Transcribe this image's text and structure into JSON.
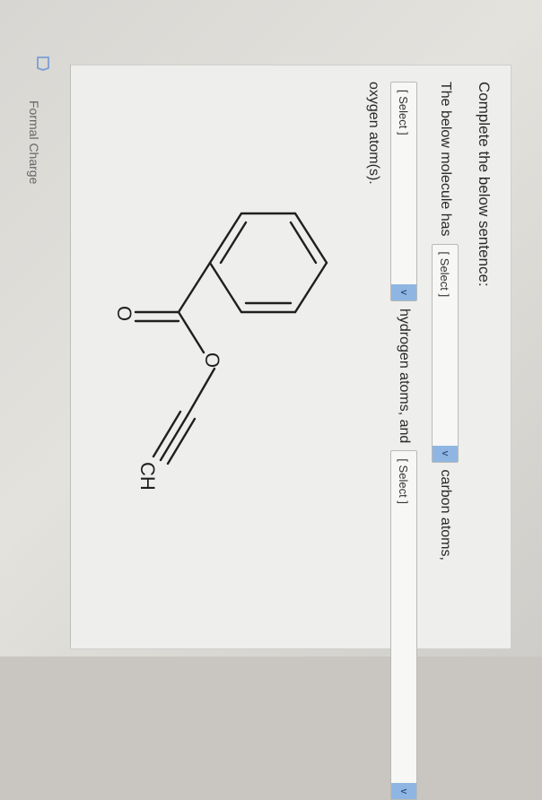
{
  "question": {
    "prompt": "Complete the below sentence:",
    "text1": "The below molecule has",
    "text2": "carbon atoms,",
    "text3": "hydrogen atoms, and",
    "text4": "oxygen atom(s).",
    "select_carbon": "[ Select ]",
    "select_hydrogen": "[ Select ]",
    "select_oxygen": "[ Select ]",
    "chevron": "v"
  },
  "molecule": {
    "atom_carbonyl_o": "O",
    "atom_ester_o": "O",
    "atom_terminal": "CH"
  },
  "footer": {
    "label": "Formal Charge"
  },
  "icons": {
    "footer_icon": "bookmark-icon",
    "dropdown_icon": "chevron-down-icon"
  },
  "colors": {
    "chevron_bg": "#8fb6e2",
    "text": "#2a2a2a"
  }
}
